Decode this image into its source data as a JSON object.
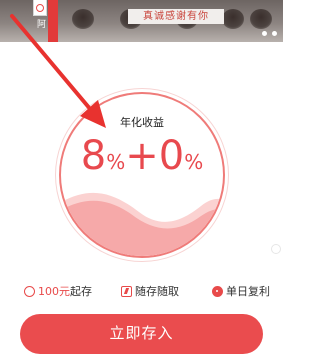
{
  "banner": {
    "edge_char": "阿",
    "slogan": "真诚感谢有你"
  },
  "yield": {
    "title": "年化收益",
    "base_value": "8",
    "base_unit": "%",
    "plus": "+",
    "bonus_value": "0",
    "bonus_unit": "%"
  },
  "features": {
    "min_amount_value": "100元",
    "min_amount_suffix": "起存",
    "flexible": "随存随取",
    "compound": "单日复利"
  },
  "deposit_button": "立即存入",
  "colors": {
    "accent": "#e8494e",
    "circle_stroke": "#ef7b79",
    "wave": "#f6a9a9"
  },
  "icons": [
    "coin-icon",
    "lightning-icon",
    "compound-dot-icon",
    "red-arrow"
  ]
}
